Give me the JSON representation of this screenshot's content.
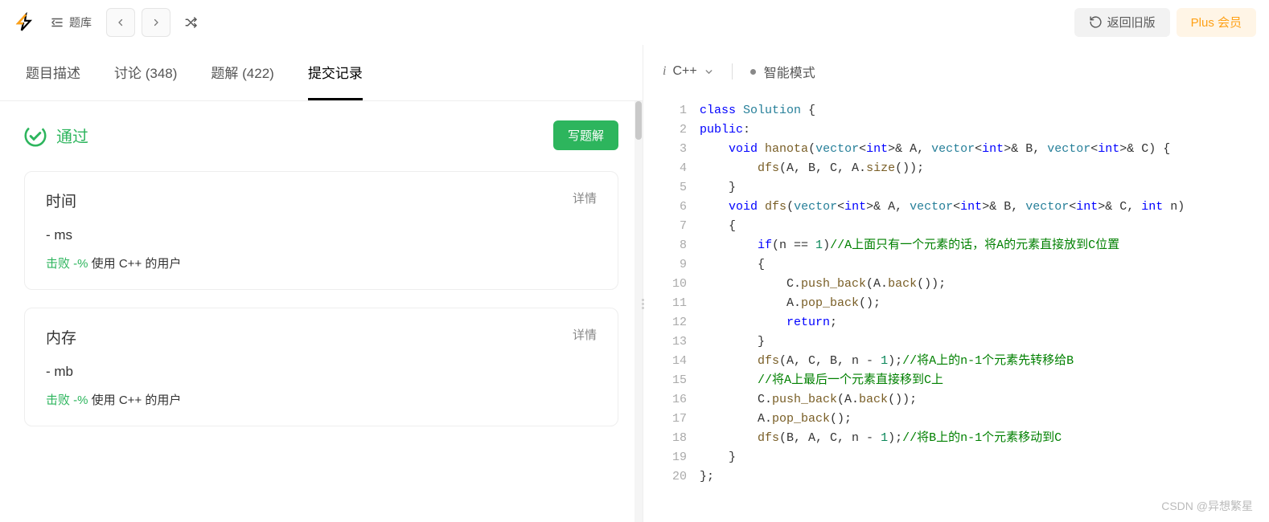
{
  "topbar": {
    "problems_label": "题库",
    "return_label": "返回旧版",
    "plus_label": "Plus 会员"
  },
  "tabs": {
    "description": "题目描述",
    "discuss": "讨论 (348)",
    "solutions": "题解 (422)",
    "submissions": "提交记录"
  },
  "status": {
    "pass_label": "通过",
    "write_solution_label": "写题解"
  },
  "cards": {
    "time": {
      "title": "时间",
      "details": "详情",
      "value": "- ms",
      "beat_prefix": "击败 -%",
      "beat_suffix": " 使用 C++ 的用户"
    },
    "memory": {
      "title": "内存",
      "details": "详情",
      "value": "- mb",
      "beat_prefix": "击败 -%",
      "beat_suffix": " 使用 C++ 的用户"
    }
  },
  "editor": {
    "language": "C++",
    "mode": "智能模式"
  },
  "code_lines": [
    "class Solution {",
    "public:",
    "    void hanota(vector<int>& A, vector<int>& B, vector<int>& C) {",
    "        dfs(A, B, C, A.size());",
    "    }",
    "    void dfs(vector<int>& A, vector<int>& B, vector<int>& C, int n)",
    "    {",
    "        if(n == 1)//A上面只有一个元素的话，将A的元素直接放到C位置",
    "        {",
    "            C.push_back(A.back());",
    "            A.pop_back();",
    "            return;",
    "        }",
    "        dfs(A, C, B, n - 1);//将A上的n-1个元素先转移给B",
    "        //将A上最后一个元素直接移到C上",
    "        C.push_back(A.back());",
    "        A.pop_back();",
    "        dfs(B, A, C, n - 1);//将B上的n-1个元素移动到C",
    "    }",
    "};"
  ],
  "watermark": "CSDN @异想繁星"
}
